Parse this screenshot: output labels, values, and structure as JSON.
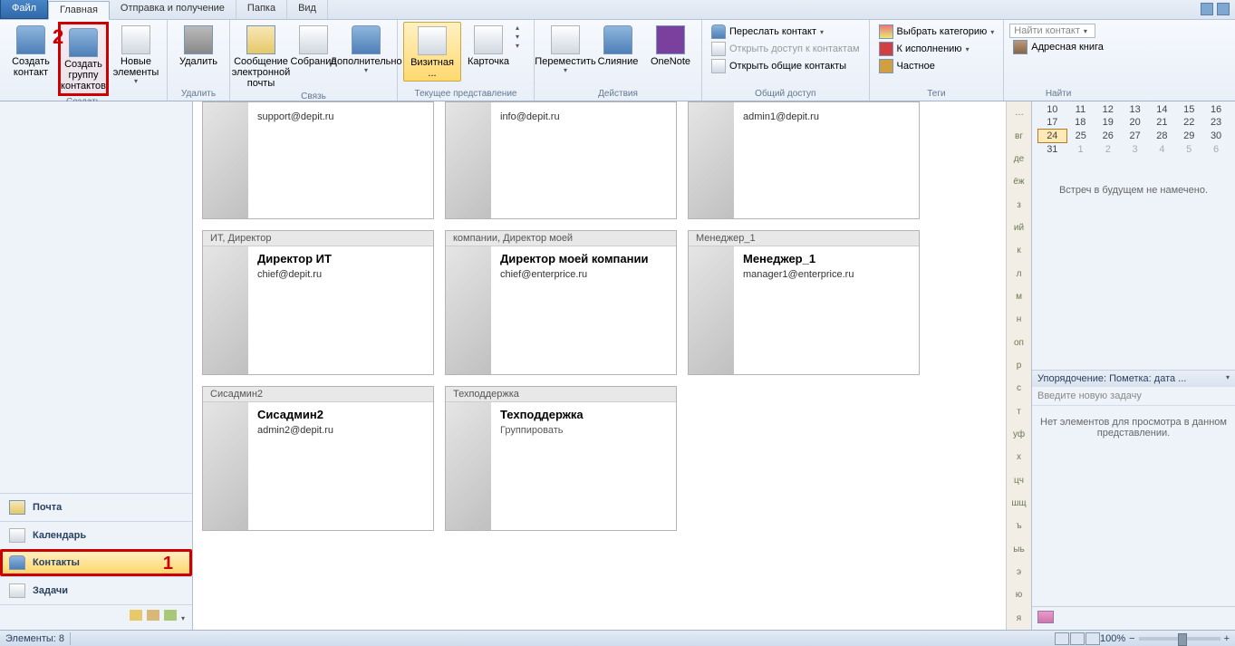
{
  "tabs": {
    "file": "Файл",
    "home": "Главная",
    "sendrecv": "Отправка и получение",
    "folder": "Папка",
    "view": "Вид"
  },
  "ribbon": {
    "create": {
      "label": "Создать",
      "new_contact": "Создать контакт",
      "new_group": "Создать группу контактов",
      "new_items": "Новые элементы"
    },
    "delete": {
      "label": "Удалить",
      "btn": "Удалить"
    },
    "communicate": {
      "label": "Связь",
      "email": "Сообщение электронной почты",
      "meeting": "Собрание",
      "more": "Дополнительно"
    },
    "view": {
      "label": "Текущее представление",
      "card": "Визитная ...",
      "bizcard": "Карточка"
    },
    "actions": {
      "label": "Действия",
      "move": "Переместить",
      "merge": "Слияние",
      "onenote": "OneNote"
    },
    "share": {
      "label": "Общий доступ",
      "forward": "Переслать контакт",
      "open_shared": "Открыть доступ к контактам",
      "open_common": "Открыть общие контакты"
    },
    "tags": {
      "label": "Теги",
      "categorize": "Выбрать категорию",
      "followup": "К исполнению",
      "private": "Частное"
    },
    "find": {
      "label": "Найти",
      "search": "Найти контакт",
      "addressbook": "Адресная книга"
    }
  },
  "annotations": {
    "n1": "1",
    "n2": "2"
  },
  "nav": {
    "mail": "Почта",
    "calendar": "Календарь",
    "contacts": "Контакты",
    "tasks": "Задачи"
  },
  "cards": [
    {
      "head": "",
      "name": "",
      "sub": "",
      "mail": "support@depit.ru",
      "topcut": true
    },
    {
      "head": "",
      "name": "",
      "sub": "",
      "mail": "info@depit.ru",
      "topcut": true
    },
    {
      "head": "",
      "name": "",
      "sub": "",
      "mail": "admin1@depit.ru",
      "topcut": true
    },
    {
      "head": "ИТ, Директор",
      "name": "Директор ИТ",
      "sub": "",
      "mail": "chief@depit.ru"
    },
    {
      "head": "компании, Директор моей",
      "name": "Директор моей компании",
      "sub": "",
      "mail": "chief@enterprice.ru"
    },
    {
      "head": "Менеджер_1",
      "name": "Менеджер_1",
      "sub": "",
      "mail": "manager1@enterprice.ru"
    },
    {
      "head": "Сисадмин2",
      "name": "Сисадмин2",
      "sub": "",
      "mail": "admin2@depit.ru"
    },
    {
      "head": "Техподдержка",
      "name": "Техподдержка",
      "sub": "Группировать",
      "mail": ""
    }
  ],
  "alpha": [
    "вг",
    "де",
    "ёж",
    "з",
    "ий",
    "к",
    "л",
    "м",
    "н",
    "оп",
    "р",
    "с",
    "т",
    "уф",
    "х",
    "цч",
    "шщ",
    "ъ",
    "ыь",
    "э",
    "ю",
    "я"
  ],
  "calendar": {
    "rows": [
      [
        "10",
        "11",
        "12",
        "13",
        "14",
        "15",
        "16"
      ],
      [
        "17",
        "18",
        "19",
        "20",
        "21",
        "22",
        "23"
      ],
      [
        "24",
        "25",
        "26",
        "27",
        "28",
        "29",
        "30"
      ],
      [
        "31",
        "1",
        "2",
        "3",
        "4",
        "5",
        "6"
      ]
    ],
    "current": "24",
    "appt_empty": "Встреч в будущем не намечено."
  },
  "tasks": {
    "header": "Упорядочение: Пометка: дата ...",
    "placeholder": "Введите новую задачу",
    "empty": "Нет элементов для просмотра в данном представлении."
  },
  "status": {
    "items": "Элементы: 8",
    "zoom": "100%"
  }
}
